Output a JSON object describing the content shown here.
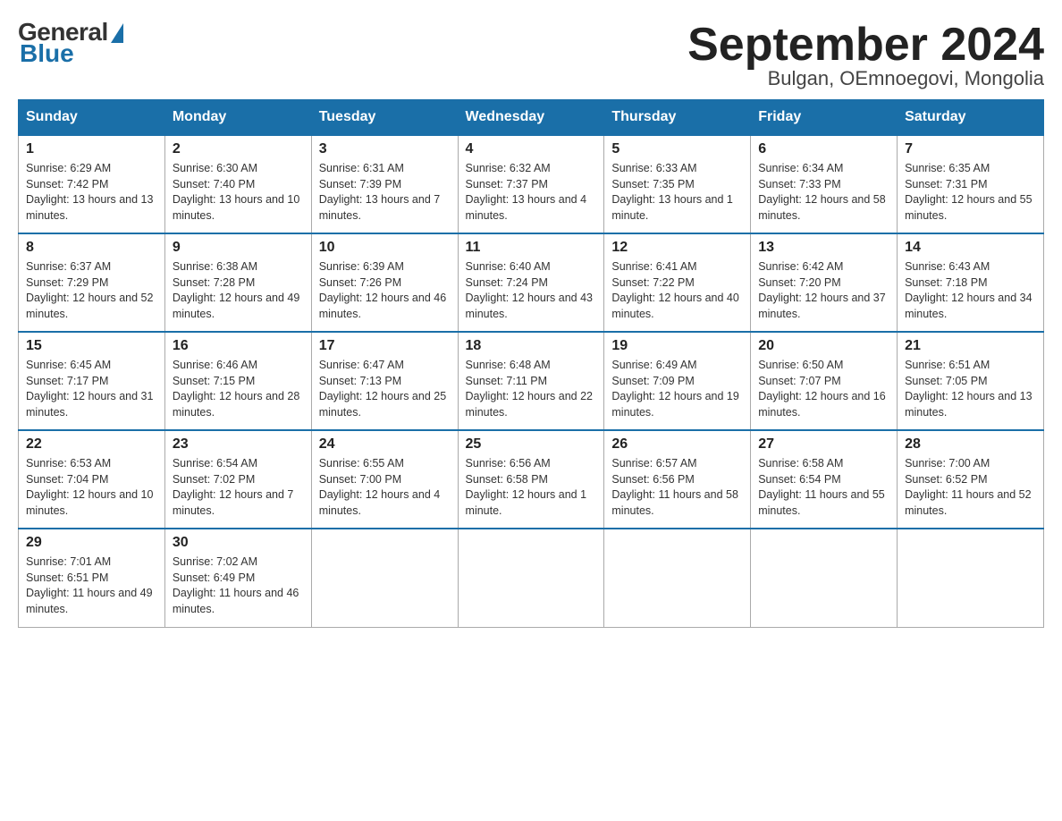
{
  "header": {
    "logo_general": "General",
    "logo_blue": "Blue",
    "month_title": "September 2024",
    "location": "Bulgan, OEmnoegovi, Mongolia"
  },
  "weekdays": [
    "Sunday",
    "Monday",
    "Tuesday",
    "Wednesday",
    "Thursday",
    "Friday",
    "Saturday"
  ],
  "weeks": [
    [
      {
        "day": "1",
        "sunrise": "6:29 AM",
        "sunset": "7:42 PM",
        "daylight": "13 hours and 13 minutes."
      },
      {
        "day": "2",
        "sunrise": "6:30 AM",
        "sunset": "7:40 PM",
        "daylight": "13 hours and 10 minutes."
      },
      {
        "day": "3",
        "sunrise": "6:31 AM",
        "sunset": "7:39 PM",
        "daylight": "13 hours and 7 minutes."
      },
      {
        "day": "4",
        "sunrise": "6:32 AM",
        "sunset": "7:37 PM",
        "daylight": "13 hours and 4 minutes."
      },
      {
        "day": "5",
        "sunrise": "6:33 AM",
        "sunset": "7:35 PM",
        "daylight": "13 hours and 1 minute."
      },
      {
        "day": "6",
        "sunrise": "6:34 AM",
        "sunset": "7:33 PM",
        "daylight": "12 hours and 58 minutes."
      },
      {
        "day": "7",
        "sunrise": "6:35 AM",
        "sunset": "7:31 PM",
        "daylight": "12 hours and 55 minutes."
      }
    ],
    [
      {
        "day": "8",
        "sunrise": "6:37 AM",
        "sunset": "7:29 PM",
        "daylight": "12 hours and 52 minutes."
      },
      {
        "day": "9",
        "sunrise": "6:38 AM",
        "sunset": "7:28 PM",
        "daylight": "12 hours and 49 minutes."
      },
      {
        "day": "10",
        "sunrise": "6:39 AM",
        "sunset": "7:26 PM",
        "daylight": "12 hours and 46 minutes."
      },
      {
        "day": "11",
        "sunrise": "6:40 AM",
        "sunset": "7:24 PM",
        "daylight": "12 hours and 43 minutes."
      },
      {
        "day": "12",
        "sunrise": "6:41 AM",
        "sunset": "7:22 PM",
        "daylight": "12 hours and 40 minutes."
      },
      {
        "day": "13",
        "sunrise": "6:42 AM",
        "sunset": "7:20 PM",
        "daylight": "12 hours and 37 minutes."
      },
      {
        "day": "14",
        "sunrise": "6:43 AM",
        "sunset": "7:18 PM",
        "daylight": "12 hours and 34 minutes."
      }
    ],
    [
      {
        "day": "15",
        "sunrise": "6:45 AM",
        "sunset": "7:17 PM",
        "daylight": "12 hours and 31 minutes."
      },
      {
        "day": "16",
        "sunrise": "6:46 AM",
        "sunset": "7:15 PM",
        "daylight": "12 hours and 28 minutes."
      },
      {
        "day": "17",
        "sunrise": "6:47 AM",
        "sunset": "7:13 PM",
        "daylight": "12 hours and 25 minutes."
      },
      {
        "day": "18",
        "sunrise": "6:48 AM",
        "sunset": "7:11 PM",
        "daylight": "12 hours and 22 minutes."
      },
      {
        "day": "19",
        "sunrise": "6:49 AM",
        "sunset": "7:09 PM",
        "daylight": "12 hours and 19 minutes."
      },
      {
        "day": "20",
        "sunrise": "6:50 AM",
        "sunset": "7:07 PM",
        "daylight": "12 hours and 16 minutes."
      },
      {
        "day": "21",
        "sunrise": "6:51 AM",
        "sunset": "7:05 PM",
        "daylight": "12 hours and 13 minutes."
      }
    ],
    [
      {
        "day": "22",
        "sunrise": "6:53 AM",
        "sunset": "7:04 PM",
        "daylight": "12 hours and 10 minutes."
      },
      {
        "day": "23",
        "sunrise": "6:54 AM",
        "sunset": "7:02 PM",
        "daylight": "12 hours and 7 minutes."
      },
      {
        "day": "24",
        "sunrise": "6:55 AM",
        "sunset": "7:00 PM",
        "daylight": "12 hours and 4 minutes."
      },
      {
        "day": "25",
        "sunrise": "6:56 AM",
        "sunset": "6:58 PM",
        "daylight": "12 hours and 1 minute."
      },
      {
        "day": "26",
        "sunrise": "6:57 AM",
        "sunset": "6:56 PM",
        "daylight": "11 hours and 58 minutes."
      },
      {
        "day": "27",
        "sunrise": "6:58 AM",
        "sunset": "6:54 PM",
        "daylight": "11 hours and 55 minutes."
      },
      {
        "day": "28",
        "sunrise": "7:00 AM",
        "sunset": "6:52 PM",
        "daylight": "11 hours and 52 minutes."
      }
    ],
    [
      {
        "day": "29",
        "sunrise": "7:01 AM",
        "sunset": "6:51 PM",
        "daylight": "11 hours and 49 minutes."
      },
      {
        "day": "30",
        "sunrise": "7:02 AM",
        "sunset": "6:49 PM",
        "daylight": "11 hours and 46 minutes."
      },
      null,
      null,
      null,
      null,
      null
    ]
  ]
}
